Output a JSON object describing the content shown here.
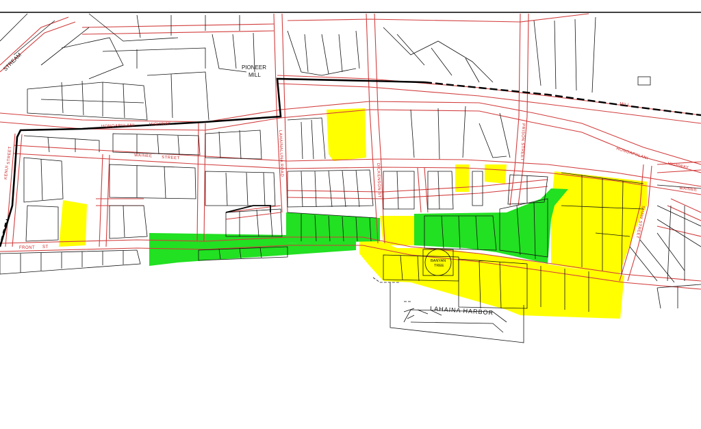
{
  "map": {
    "labels": {
      "stream": "STREAM",
      "pioneer_mill_1": "PIONEER",
      "pioneer_mill_2": "MILL",
      "honoapiilani_hwy_west_1": "HONOAPIILANI",
      "honoapiilani_hwy_west_2": "HIGHWAY",
      "honoapiilani_hwy_east_1": "HONOAPIILANI",
      "honoapiilani_hwy_east_2": "HIGHWAY",
      "mill": "MILL",
      "wainee_street_1": "WAINEE",
      "wainee_street_2": "STREET",
      "wainee_east": "WAINEE",
      "kenui_street_1": "KENUI",
      "kenui_street_2": "STREET",
      "front_st_1": "FRONT",
      "front_st_2": "ST",
      "lahainaluna_road": "LAHAINALUNA ROAD",
      "dickenson_st": "DICKENSON ST",
      "prison_street": "PRISON STREET",
      "hotel_street": "SHAW STREET",
      "banyan_tree_1": "BANYAN",
      "banyan_tree_2": "TREE",
      "lahaina_harbor": "LAHAINA HARBOR"
    },
    "colors": {
      "street_lines": "#d23c3c",
      "parcel_lines": "#111111",
      "zone_yellow": "#ffff00",
      "zone_green": "#22e022",
      "boundary": "#000000"
    }
  }
}
